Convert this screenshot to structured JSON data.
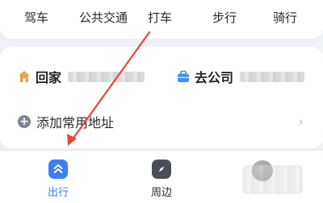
{
  "transport_modes": [
    "驾车",
    "公共交通",
    "打车",
    "步行",
    "骑行"
  ],
  "addresses": {
    "home": {
      "label": "回家",
      "icon": "house-icon"
    },
    "work": {
      "label": "去公司",
      "icon": "briefcase-icon"
    }
  },
  "add_address": {
    "label": "添加常用地址",
    "icon": "plus-circle-icon"
  },
  "tabs": [
    {
      "label": "出行",
      "icon": "travel-icon",
      "active": true
    },
    {
      "label": "周边",
      "icon": "compass-icon",
      "active": false
    },
    {
      "label": "",
      "icon": "avatar-icon",
      "active": false
    }
  ],
  "colors": {
    "accent": "#3d7ef5",
    "annotation_arrow": "#e8453c",
    "home_icon": "#f0a23a",
    "work_icon": "#3d8ff5"
  }
}
